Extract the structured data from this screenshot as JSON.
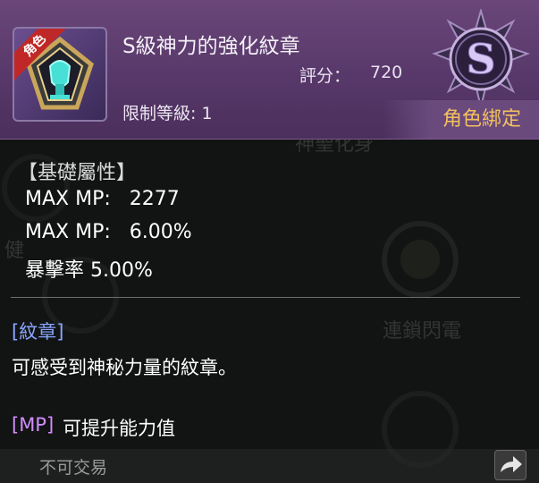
{
  "item": {
    "name": "S級神力的強化紋章",
    "ribbon": "角色",
    "score_label": "評分：",
    "score_value": "720",
    "level_req": "限制等級: 1",
    "grade": "S",
    "bind": "角色綁定"
  },
  "attributes": {
    "header": "【基礎屬性】",
    "lines": [
      "MAX MP:   2277",
      "MAX MP:   6.00%",
      "暴擊率 5.00%"
    ]
  },
  "description": {
    "tag": "[紋章]",
    "text": "可感受到神秘力量的紋章。",
    "mp_tag": "[MP]",
    "mp_text": "可提升能力值"
  },
  "footer": {
    "trade": "不可交易"
  },
  "background": {
    "ghost_labels": [
      "神聖化身",
      "健",
      "連鎖閃電"
    ]
  },
  "colors": {
    "header_bg": "#58386a",
    "bind_text": "#f2c15e",
    "emblem_tag": "#8aa6ff",
    "mp_tag": "#d38cff"
  },
  "icons": {
    "item": "crest-gem-icon",
    "grade": "s-grade-emblem-icon",
    "share": "share-arrow-icon"
  }
}
